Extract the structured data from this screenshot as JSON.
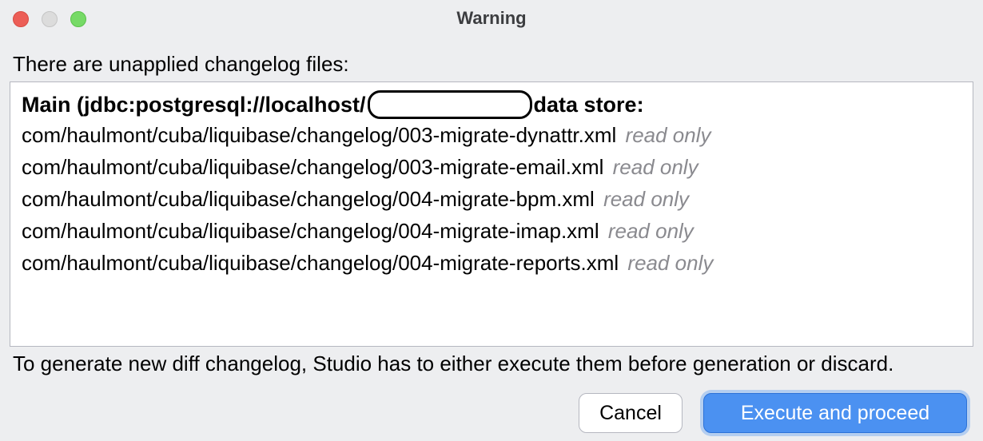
{
  "window": {
    "title": "Warning"
  },
  "message": {
    "lead": "There are unapplied changelog files:"
  },
  "datastore": {
    "prefix": "Main (jdbc:postgresql://localhost/",
    "suffix": "data store:"
  },
  "files": [
    {
      "path": "com/haulmont/cuba/liquibase/changelog/003-migrate-dynattr.xml",
      "status": "read only"
    },
    {
      "path": "com/haulmont/cuba/liquibase/changelog/003-migrate-email.xml",
      "status": "read only"
    },
    {
      "path": "com/haulmont/cuba/liquibase/changelog/004-migrate-bpm.xml",
      "status": "read only"
    },
    {
      "path": "com/haulmont/cuba/liquibase/changelog/004-migrate-imap.xml",
      "status": "read only"
    },
    {
      "path": "com/haulmont/cuba/liquibase/changelog/004-migrate-reports.xml",
      "status": "read only"
    }
  ],
  "message_after": "To generate new diff changelog, Studio has to either execute them before generation or discard.",
  "buttons": {
    "cancel": "Cancel",
    "proceed": "Execute and proceed"
  }
}
